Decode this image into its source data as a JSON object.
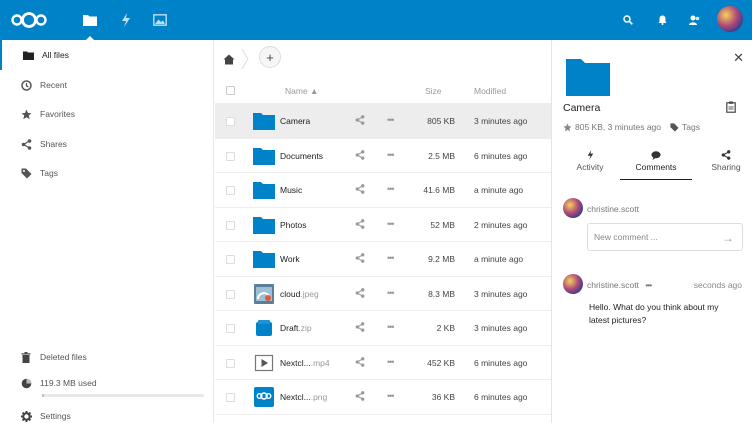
{
  "colors": {
    "brand": "#0082c9",
    "folder": "#0082c9"
  },
  "header": {
    "apps": [
      {
        "name": "files",
        "icon": "folder-icon",
        "active": true
      },
      {
        "name": "activity",
        "icon": "lightning-icon"
      },
      {
        "name": "gallery",
        "icon": "image-icon"
      }
    ],
    "right_icons": [
      "search-icon",
      "bell-icon",
      "contacts-icon",
      "avatar"
    ]
  },
  "sidebar": {
    "items": [
      {
        "label": "All files",
        "icon": "folder-icon"
      },
      {
        "label": "Recent",
        "icon": "clock-icon"
      },
      {
        "label": "Favorites",
        "icon": "star-icon"
      },
      {
        "label": "Shares",
        "icon": "share-icon"
      },
      {
        "label": "Tags",
        "icon": "tag-icon"
      }
    ],
    "bottom": {
      "deleted": "Deleted files",
      "quota": "119.3 MB used",
      "quota_fraction": 0.0,
      "settings": "Settings"
    }
  },
  "filelist": {
    "columns": {
      "name": "Name ▲",
      "size": "Size",
      "modified": "Modified"
    },
    "add_label": "+",
    "rows": [
      {
        "name": "Camera",
        "ext": "",
        "type": "folder",
        "size": "805 KB",
        "modified": "3 minutes ago",
        "selected": true
      },
      {
        "name": "Documents",
        "ext": "",
        "type": "folder",
        "size": "2.5 MB",
        "modified": "6 minutes ago"
      },
      {
        "name": "Music",
        "ext": "",
        "type": "folder",
        "size": "41.6 MB",
        "modified": "a minute ago"
      },
      {
        "name": "Photos",
        "ext": "",
        "type": "folder",
        "size": "52 MB",
        "modified": "2 minutes ago"
      },
      {
        "name": "Work",
        "ext": "",
        "type": "folder",
        "size": "9.2 MB",
        "modified": "a minute ago"
      },
      {
        "name": "cloud",
        "ext": ".jpeg",
        "type": "image",
        "size": "8.3 MB",
        "modified": "3 minutes ago"
      },
      {
        "name": "Draft",
        "ext": ".zip",
        "type": "zip",
        "size": "2 KB",
        "modified": "3 minutes ago"
      },
      {
        "name": "Nextcl...",
        "ext": ".mp4",
        "type": "video",
        "size": "452 KB",
        "modified": "6 minutes ago"
      },
      {
        "name": "Nextcl...",
        "ext": ".png",
        "type": "png",
        "size": "36 KB",
        "modified": "6 minutes ago"
      }
    ]
  },
  "details": {
    "title": "Camera",
    "meta_size": "805 KB, 3 minutes ago",
    "meta_tags": "Tags",
    "tabs": [
      {
        "label": "Activity",
        "icon": "lightning-icon"
      },
      {
        "label": "Comments",
        "icon": "comment-icon",
        "active": true
      },
      {
        "label": "Sharing",
        "icon": "share-icon"
      }
    ],
    "current_user": "christine.scott",
    "comment_placeholder": "New comment ...",
    "comments": [
      {
        "user": "christine.scott",
        "more": "•••",
        "time": "seconds ago",
        "text": "Hello. What do you think about my latest pictures?"
      }
    ]
  }
}
